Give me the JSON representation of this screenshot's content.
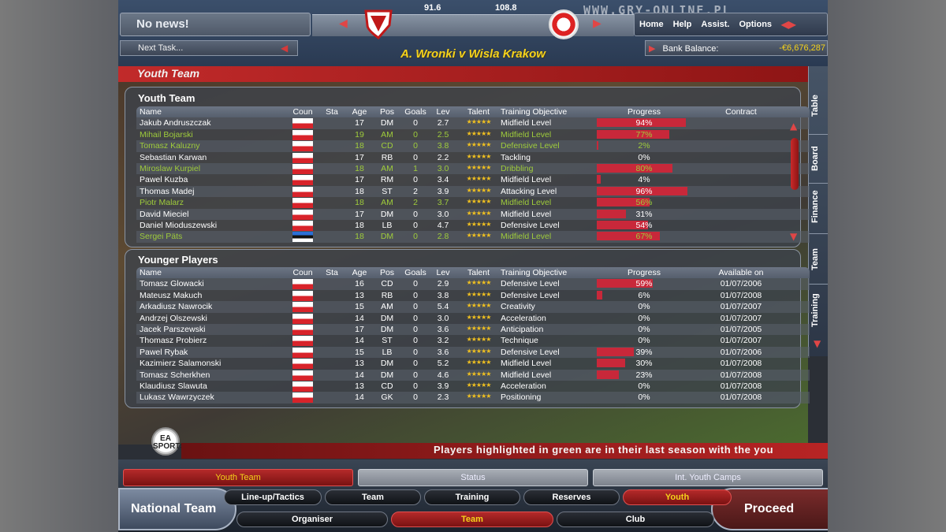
{
  "header": {
    "news": "No news!",
    "next_task": "Next Task...",
    "score_left": "91.6",
    "score_right": "108.8",
    "match_title": "A. Wronki v Wisla Krakow",
    "watermark": "WWW.GRY-ONLINE.PL",
    "menu": [
      "Home",
      "Help",
      "Assist.",
      "Options"
    ],
    "bank_label": "Bank Balance:",
    "bank_value": "-€6,676,287"
  },
  "section_title": "Youth Team",
  "side_tabs": [
    "Table",
    "Board",
    "Finance",
    "Team",
    "Training"
  ],
  "youth_team": {
    "title": "Youth Team",
    "columns": [
      "Name",
      "Coun",
      "Sta",
      "Age",
      "Pos",
      "Goals",
      "Lev",
      "Talent",
      "Training Objective",
      "Progress",
      "Contract"
    ],
    "rows": [
      {
        "name": "Jakub Andruszczak",
        "flag": "pl",
        "age": "17",
        "pos": "DM",
        "goals": "0",
        "lev": "2.7",
        "objective": "Midfield Level",
        "progress": 94,
        "progress_text": "94%",
        "green": false
      },
      {
        "name": "Mihail Bojarski",
        "flag": "pl",
        "age": "19",
        "pos": "AM",
        "goals": "0",
        "lev": "2.5",
        "objective": "Midfield Level",
        "progress": 77,
        "progress_text": "77%",
        "green": true
      },
      {
        "name": "Tomasz Kaluzny",
        "flag": "pl",
        "age": "18",
        "pos": "CD",
        "goals": "0",
        "lev": "3.8",
        "objective": "Defensive Level",
        "progress": 2,
        "progress_text": "2%",
        "green": true
      },
      {
        "name": "Sebastian Karwan",
        "flag": "pl",
        "age": "17",
        "pos": "RB",
        "goals": "0",
        "lev": "2.2",
        "objective": "Tackling",
        "progress": 0,
        "progress_text": "0%",
        "green": false
      },
      {
        "name": "Miroslaw Kurpiel",
        "flag": "pl",
        "age": "18",
        "pos": "AM",
        "goals": "1",
        "lev": "3.0",
        "objective": "Dribbling",
        "progress": 80,
        "progress_text": "80%",
        "green": true
      },
      {
        "name": "Pawel Kuzba",
        "flag": "pl",
        "age": "17",
        "pos": "RM",
        "goals": "0",
        "lev": "3.4",
        "objective": "Midfield Level",
        "progress": 4,
        "progress_text": "4%",
        "green": false
      },
      {
        "name": "Thomas Madej",
        "flag": "pl",
        "age": "18",
        "pos": "ST",
        "goals": "2",
        "lev": "3.9",
        "objective": "Attacking Level",
        "progress": 96,
        "progress_text": "96%",
        "green": false
      },
      {
        "name": "Piotr Malarz",
        "flag": "pl",
        "age": "18",
        "pos": "AM",
        "goals": "2",
        "lev": "3.7",
        "objective": "Midfield Level",
        "progress": 56,
        "progress_text": "56%",
        "green": true
      },
      {
        "name": "David Mieciel",
        "flag": "pl",
        "age": "17",
        "pos": "DM",
        "goals": "0",
        "lev": "3.0",
        "objective": "Midfield Level",
        "progress": 31,
        "progress_text": "31%",
        "green": false
      },
      {
        "name": "Daniel Mioduszewski",
        "flag": "pl",
        "age": "18",
        "pos": "LB",
        "goals": "0",
        "lev": "4.7",
        "objective": "Defensive Level",
        "progress": 54,
        "progress_text": "54%",
        "green": false
      },
      {
        "name": "Sergei Päts",
        "flag": "ee",
        "age": "18",
        "pos": "DM",
        "goals": "0",
        "lev": "2.8",
        "objective": "Midfield Level",
        "progress": 67,
        "progress_text": "67%",
        "green": true
      }
    ]
  },
  "younger_players": {
    "title": "Younger Players",
    "columns": [
      "Name",
      "Coun",
      "Sta",
      "Age",
      "Pos",
      "Goals",
      "Lev",
      "Talent",
      "Training Objective",
      "Progress",
      "Available on"
    ],
    "rows": [
      {
        "name": "Tomasz Glowacki",
        "flag": "pl",
        "age": "16",
        "pos": "CD",
        "goals": "0",
        "lev": "2.9",
        "objective": "Defensive Level",
        "progress": 59,
        "progress_text": "59%",
        "available": "01/07/2006"
      },
      {
        "name": "Mateusz Makuch",
        "flag": "pl",
        "age": "13",
        "pos": "RB",
        "goals": "0",
        "lev": "3.8",
        "objective": "Defensive Level",
        "progress": 6,
        "progress_text": "6%",
        "available": "01/07/2008"
      },
      {
        "name": "Arkadiusz Nawrocik",
        "flag": "pl",
        "age": "15",
        "pos": "AM",
        "goals": "0",
        "lev": "5.4",
        "objective": "Creativity",
        "progress": 0,
        "progress_text": "0%",
        "available": "01/07/2007"
      },
      {
        "name": "Andrzej Olszewski",
        "flag": "pl",
        "age": "14",
        "pos": "DM",
        "goals": "0",
        "lev": "3.0",
        "objective": "Acceleration",
        "progress": 0,
        "progress_text": "0%",
        "available": "01/07/2007"
      },
      {
        "name": "Jacek Parszewski",
        "flag": "pl",
        "age": "17",
        "pos": "DM",
        "goals": "0",
        "lev": "3.6",
        "objective": "Anticipation",
        "progress": 0,
        "progress_text": "0%",
        "available": "01/07/2005"
      },
      {
        "name": "Thomasz Probierz",
        "flag": "pl",
        "age": "14",
        "pos": "ST",
        "goals": "0",
        "lev": "3.2",
        "objective": "Technique",
        "progress": 0,
        "progress_text": "0%",
        "available": "01/07/2007"
      },
      {
        "name": "Pawel Rybak",
        "flag": "pl",
        "age": "15",
        "pos": "LB",
        "goals": "0",
        "lev": "3.6",
        "objective": "Defensive Level",
        "progress": 39,
        "progress_text": "39%",
        "available": "01/07/2006"
      },
      {
        "name": "Kazimierz Salamonski",
        "flag": "pl",
        "age": "13",
        "pos": "DM",
        "goals": "0",
        "lev": "5.2",
        "objective": "Midfield Level",
        "progress": 30,
        "progress_text": "30%",
        "available": "01/07/2008"
      },
      {
        "name": "Tomasz Scherkhen",
        "flag": "pl",
        "age": "14",
        "pos": "DM",
        "goals": "0",
        "lev": "4.6",
        "objective": "Midfield Level",
        "progress": 23,
        "progress_text": "23%",
        "available": "01/07/2008"
      },
      {
        "name": "Klaudiusz Slawuta",
        "flag": "pl",
        "age": "13",
        "pos": "CD",
        "goals": "0",
        "lev": "3.9",
        "objective": "Acceleration",
        "progress": 0,
        "progress_text": "0%",
        "available": "01/07/2008"
      },
      {
        "name": "Lukasz Wawrzyczek",
        "flag": "pl",
        "age": "14",
        "pos": "GK",
        "goals": "0",
        "lev": "2.3",
        "objective": "Positioning",
        "progress": 0,
        "progress_text": "0%",
        "available": "01/07/2008"
      }
    ]
  },
  "info_text": "Players highlighted in green are in their last season with the you",
  "ea_logo": "EA SPORTS",
  "bottom": {
    "tabs": [
      {
        "label": "Youth Team",
        "active": true
      },
      {
        "label": "Status",
        "active": false
      },
      {
        "label": "Int. Youth Camps",
        "active": false
      }
    ],
    "left_button": "National Team",
    "right_button": "Proceed",
    "row1": [
      {
        "label": "Line-up/Tactics",
        "active": false
      },
      {
        "label": "Team",
        "active": false
      },
      {
        "label": "Training",
        "active": false
      },
      {
        "label": "Reserves",
        "active": false
      },
      {
        "label": "Youth",
        "active": true
      }
    ],
    "row2": [
      {
        "label": "Organiser",
        "active": false
      },
      {
        "label": "Team",
        "active": true
      },
      {
        "label": "Club",
        "active": false
      }
    ]
  },
  "colors": {
    "accent_red": "#c8283a",
    "highlight_green": "#9fcc3b",
    "title_yellow": "#f5d21a"
  }
}
